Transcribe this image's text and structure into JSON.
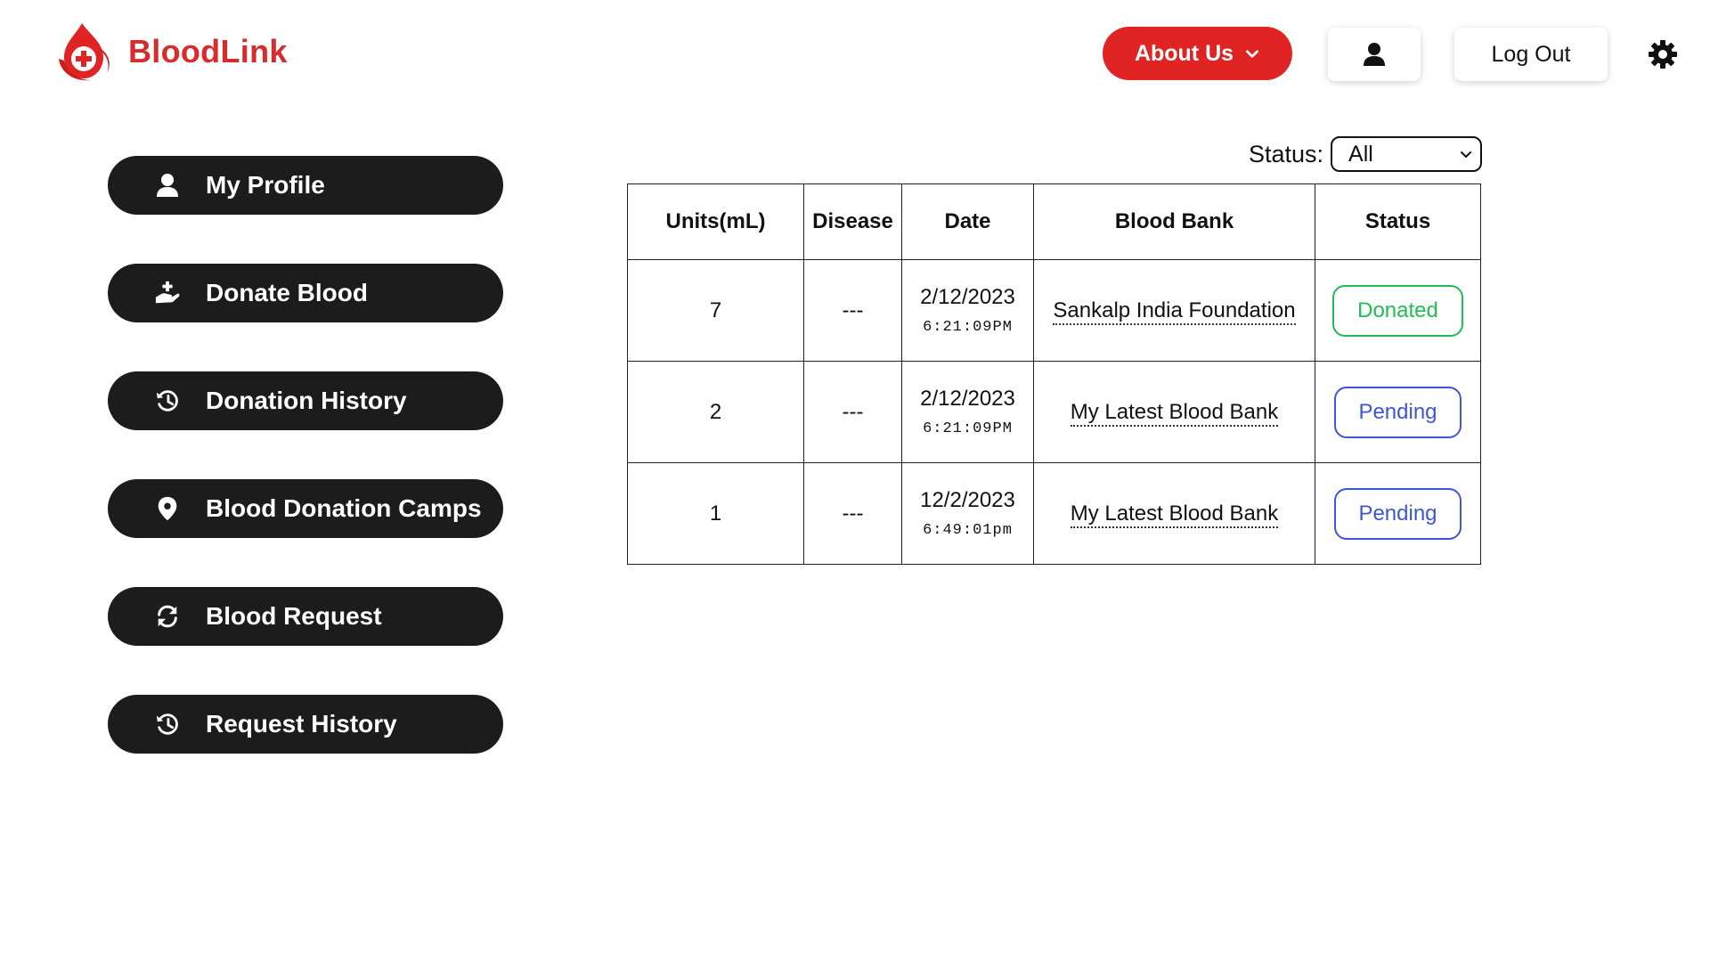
{
  "brand": {
    "name": "BloodLink",
    "color": "#d92b2b"
  },
  "header": {
    "about_label": "About Us",
    "logout_label": "Log Out",
    "accent_color": "#e02424",
    "icons": [
      "chevron-down-icon",
      "user-icon",
      "gear-icon"
    ]
  },
  "sidebar": {
    "items": [
      {
        "label": "My Profile",
        "icon": "user-icon"
      },
      {
        "label": "Donate Blood",
        "icon": "donate-hand-icon"
      },
      {
        "label": "Donation History",
        "icon": "history-icon"
      },
      {
        "label": "Blood Donation Camps",
        "icon": "location-pin-icon"
      },
      {
        "label": "Blood Request",
        "icon": "refresh-icon"
      },
      {
        "label": "Request History",
        "icon": "history-icon"
      }
    ]
  },
  "filter": {
    "label": "Status:",
    "selected": "All"
  },
  "table": {
    "headers": [
      "Units(mL)",
      "Disease",
      "Date",
      "Blood Bank",
      "Status"
    ],
    "rows": [
      {
        "units": "7",
        "disease": "---",
        "date": "2/12/2023",
        "time": "6:21:09PM",
        "bank": "Sankalp India Foundation",
        "status": "Donated",
        "status_color": "#22bb55"
      },
      {
        "units": "2",
        "disease": "---",
        "date": "2/12/2023",
        "time": "6:21:09PM",
        "bank": "My Latest Blood Bank",
        "status": "Pending",
        "status_color": "#3f55d8"
      },
      {
        "units": "1",
        "disease": "---",
        "date": "12/2/2023",
        "time": "6:49:01pm",
        "bank": "My Latest Blood Bank",
        "status": "Pending",
        "status_color": "#3f55d8"
      }
    ]
  }
}
